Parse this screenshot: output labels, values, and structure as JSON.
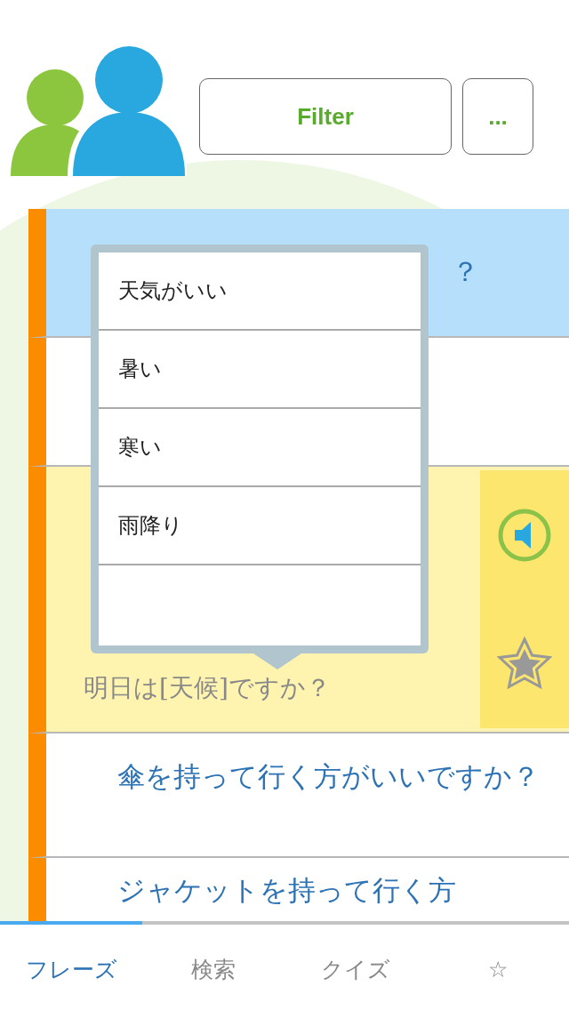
{
  "header": {
    "filter_button": "Filter",
    "more_button": "..."
  },
  "rows": [
    {
      "kind": "covered",
      "text": "？",
      "selected": true
    },
    {
      "kind": "covered",
      "selected": false
    },
    {
      "kind": "expanded",
      "example": "明日は[天候]ですか？",
      "selected": false
    },
    {
      "kind": "plain",
      "text": "傘を持って行く方がいいですか？",
      "selected": false
    },
    {
      "kind": "plain",
      "text": "ジャケットを持って行く方",
      "selected": false
    }
  ],
  "popover": {
    "items": [
      {
        "kind": "option",
        "text": "天気がいい"
      },
      {
        "kind": "option",
        "text": "暑い"
      },
      {
        "kind": "option",
        "text": "寒い"
      },
      {
        "kind": "option",
        "text": "雨降り"
      },
      {
        "kind": "blank"
      }
    ]
  },
  "tabs": [
    {
      "label": "フレーズ",
      "selected": true
    },
    {
      "label": "検索",
      "selected": false
    },
    {
      "label": "クイズ",
      "selected": false
    },
    {
      "label": "☆",
      "selected": false
    }
  ]
}
